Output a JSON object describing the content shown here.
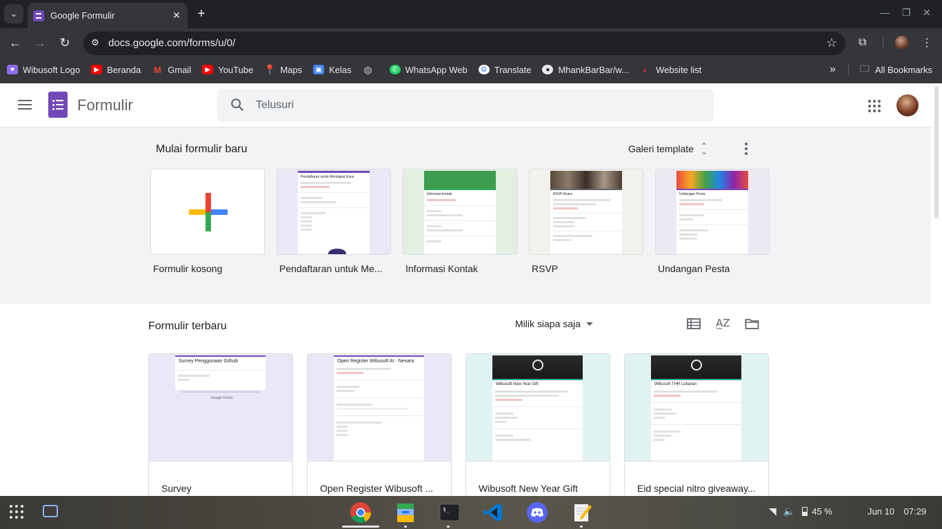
{
  "browser": {
    "tab_title": "Google Formulir",
    "url": "docs.google.com/forms/u/0/",
    "bookmarks": [
      {
        "label": "Wibusoft Logo",
        "icon": "wibusoft-icon"
      },
      {
        "label": "Beranda",
        "icon": "youtube-icon"
      },
      {
        "label": "Gmail",
        "icon": "gmail-icon"
      },
      {
        "label": "YouTube",
        "icon": "youtube-icon"
      },
      {
        "label": "Maps",
        "icon": "maps-icon"
      },
      {
        "label": "Kelas",
        "icon": "classroom-icon"
      },
      {
        "label": "",
        "icon": "globe-icon"
      },
      {
        "label": "WhatsApp Web",
        "icon": "whatsapp-icon"
      },
      {
        "label": "Translate",
        "icon": "google-icon"
      },
      {
        "label": "MhankBarBar/w...",
        "icon": "github-icon"
      },
      {
        "label": "Website list",
        "icon": "website-list-icon"
      }
    ],
    "all_bookmarks": "All Bookmarks"
  },
  "app": {
    "title": "Formulir",
    "search_placeholder": "Telusuri"
  },
  "templates": {
    "section_title": "Mulai formulir baru",
    "gallery_label": "Galeri template",
    "items": [
      {
        "label": "Formulir kosong",
        "preview_title": ""
      },
      {
        "label": "Pendaftaran untuk Me...",
        "preview_title": "Pendaftaran untuk Mendapat Kaus"
      },
      {
        "label": "Informasi Kontak",
        "preview_title": "Informasi kontak"
      },
      {
        "label": "RSVP",
        "preview_title": "RSVP Acara"
      },
      {
        "label": "Undangan Pesta",
        "preview_title": "Undangan Pesta"
      }
    ]
  },
  "recent": {
    "section_title": "Formulir terbaru",
    "owner_filter": "Milik siapa saja",
    "forms": [
      {
        "name": "Survey",
        "preview_title": "Survey Penggunaan Github"
      },
      {
        "name": "Open Register Wibusoft ...",
        "preview_title": "Open Register Wibusoft AI - Nexara"
      },
      {
        "name": "Wibusoft New Year Gift",
        "preview_title": "Wibusoft New Year Gift"
      },
      {
        "name": "Eid special nitro giveaway...",
        "preview_title": "Wibusoft THR Lebaran"
      }
    ]
  },
  "system": {
    "battery": "45 %",
    "date": "Jun 10",
    "time": "07:29"
  },
  "colors": {
    "forms_purple": "#7248b9",
    "chrome_dark": "#35363a",
    "tab_strip": "#202124"
  }
}
